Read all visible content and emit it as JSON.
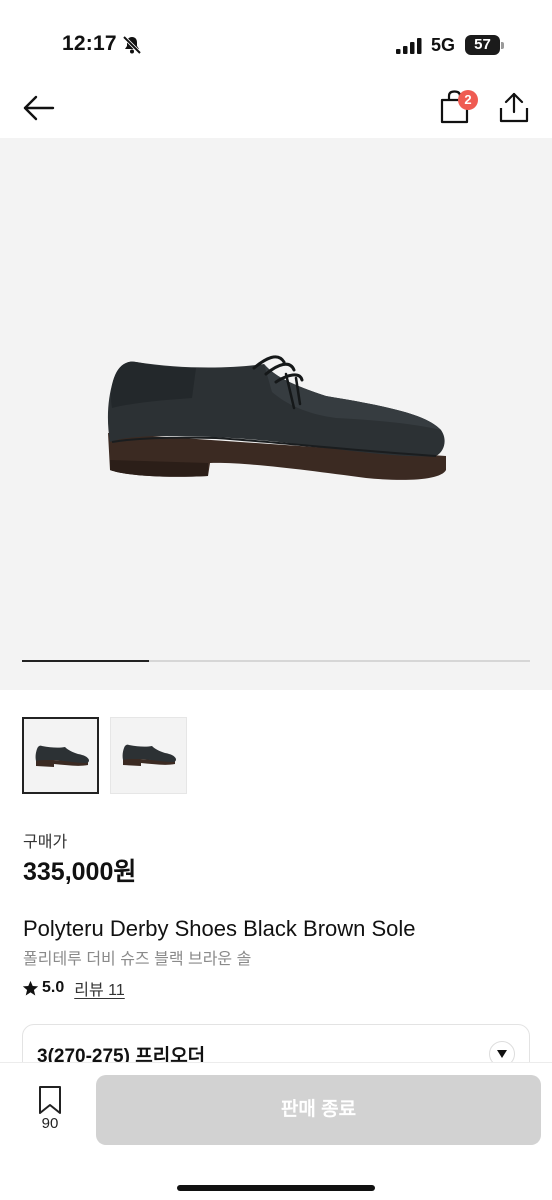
{
  "status_bar": {
    "time": "12:17",
    "network": "5G",
    "battery": "57",
    "icons": [
      "bell-slash-icon",
      "signal-icon",
      "battery-icon"
    ]
  },
  "nav": {
    "back_icon": "arrow-left-icon",
    "cart_icon": "shopping-bag-icon",
    "cart_count": "2",
    "share_icon": "share-icon",
    "badge_color": "#ef5b52"
  },
  "gallery": {
    "image_count": 2,
    "active_index": 1,
    "progress_fraction": 0.25
  },
  "product": {
    "price_label": "구매가",
    "price": "335,000원",
    "title": "Polyteru Derby Shoes Black Brown Sole",
    "subtitle": "폴리테루 더비 슈즈 블랙 브라운 솔",
    "rating": "5.0",
    "review_label": "리뷰 11"
  },
  "option": {
    "selected": "3(270-275) 프리오더",
    "chevron_icon": "chevron-down-icon"
  },
  "bottom_bar": {
    "bookmark_icon": "bookmark-icon",
    "bookmark_count": "90",
    "action_label": "판매 종료"
  }
}
